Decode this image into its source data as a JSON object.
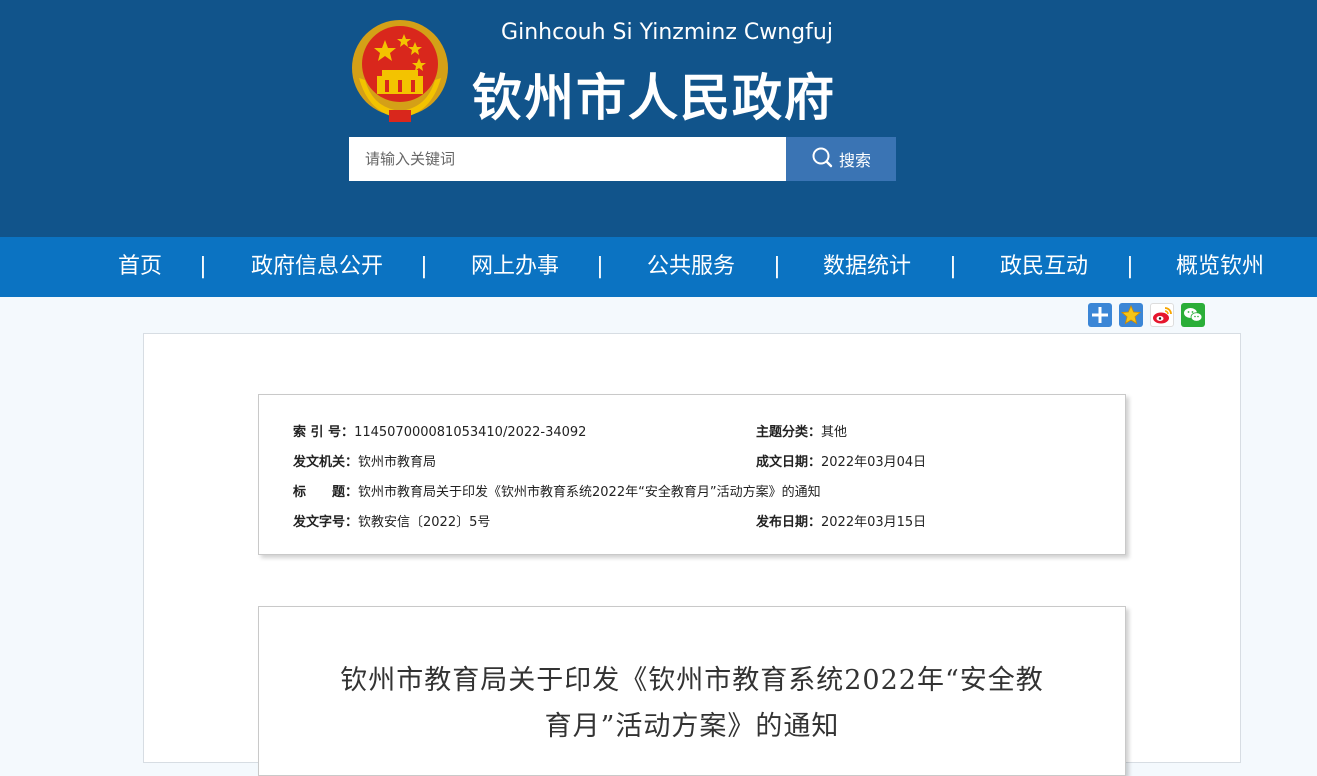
{
  "header": {
    "subtitle": "Ginhcouh Si Yinzminz Cwngfuj",
    "title": "钦州市人民政府",
    "emblem_icon": "national-emblem-icon"
  },
  "search": {
    "placeholder": "请输入关键词",
    "button_label": "搜索"
  },
  "nav": {
    "items": [
      "首页",
      "政府信息公开",
      "网上办事",
      "公共服务",
      "数据统计",
      "政民互动",
      "概览钦州"
    ],
    "separator": "|"
  },
  "share_icons": [
    "plus-share-icon",
    "favorite-star-icon",
    "weibo-icon",
    "wechat-icon"
  ],
  "meta": {
    "index_no_label": "索 引 号：",
    "index_no_value": "114507000081053410/2022-34092",
    "topic_label": "主题分类：",
    "topic_value": "其他",
    "issuer_label": "发文机关：",
    "issuer_value": "钦州市教育局",
    "created_label": "成文日期：",
    "created_value": "2022年03月04日",
    "title_label": "标　　题：",
    "title_value": "钦州市教育局关于印发《钦州市教育系统2022年“安全教育月”活动方案》的通知",
    "doc_no_label": "发文字号：",
    "doc_no_value": "钦教安信〔2022〕5号",
    "published_label": "发布日期：",
    "published_value": "2022年03月15日"
  },
  "document": {
    "title_line1": "钦州市教育局关于印发《钦州市教育系统2022年“安全教",
    "title_line2": "育月”活动方案》的通知"
  },
  "colors": {
    "header_bg": "#11548b",
    "nav_bg": "#0b73c2",
    "search_button_bg": "#3a74b4",
    "page_bg": "#f4f9fd"
  }
}
